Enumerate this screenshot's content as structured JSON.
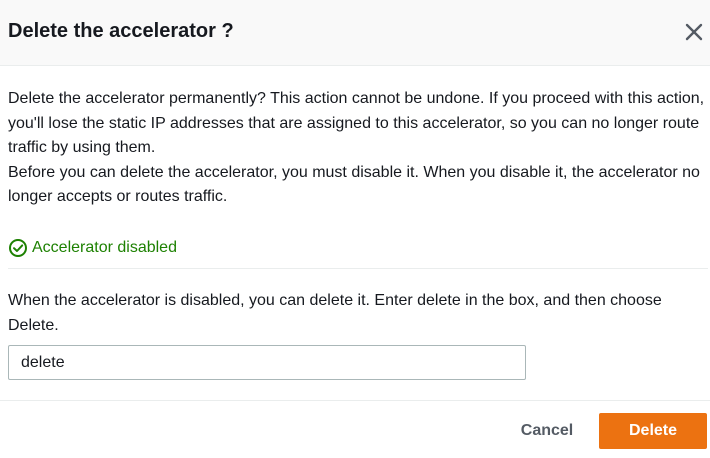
{
  "modal": {
    "title": "Delete the accelerator ?",
    "close_icon": "close-icon"
  },
  "body": {
    "paragraph1": "Delete the accelerator permanently? This action cannot be undone. If you proceed with this action, you'll lose the static IP addresses that are assigned to this accelerator, so you can no longer route traffic by using them.",
    "paragraph2": "Before you can delete the accelerator, you must disable it. When you disable it, the accelerator no longer accepts or routes traffic."
  },
  "status": {
    "icon": "check-circle-icon",
    "text": "Accelerator disabled",
    "color": "#1d8102"
  },
  "confirm": {
    "instruction": "When the accelerator is disabled, you can delete it. Enter delete in the box, and then choose Delete.",
    "input_value": "delete"
  },
  "footer": {
    "cancel_label": "Cancel",
    "delete_label": "Delete",
    "accent_color": "#ec7211"
  }
}
